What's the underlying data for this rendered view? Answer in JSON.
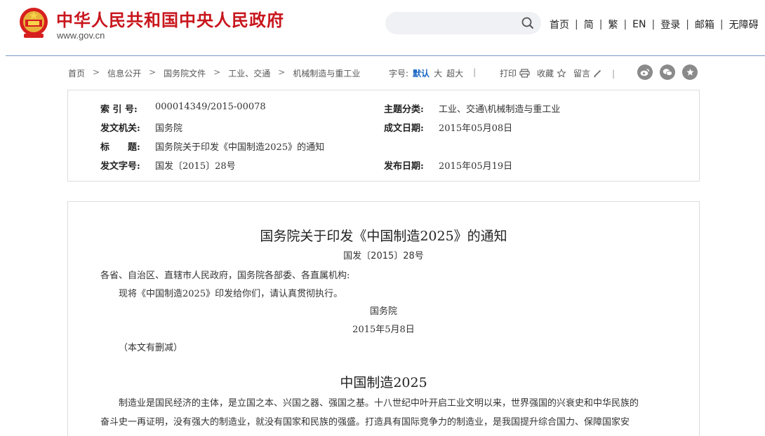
{
  "header": {
    "site_title": "中华人民共和国中央人民政府",
    "site_url": "www.gov.cn",
    "search_placeholder": "",
    "nav": [
      "首页",
      "简",
      "繁",
      "EN",
      "登录",
      "邮箱",
      "无障碍"
    ],
    "brand_color": "#c8161d"
  },
  "toolbar": {
    "breadcrumb": [
      "首页",
      "信息公开",
      "国务院文件",
      "工业、交通",
      "机械制造与重工业"
    ],
    "font_size_label": "字号:",
    "font_sizes": [
      "默认",
      "大",
      "超大"
    ],
    "font_size_selected": "默认",
    "print_label": "打印",
    "favorite_label": "收藏",
    "comment_label": "留言",
    "share_icons": [
      "weibo-icon",
      "wechat-icon",
      "favorite-star-icon"
    ]
  },
  "info": {
    "index_label": "索 引 号:",
    "index_value": "000014349/2015-00078",
    "category_label": "主题分类:",
    "category_value": "工业、交通\\机械制造与重工业",
    "issuer_label": "发文机关:",
    "issuer_value": "国务院",
    "written_date_label": "成文日期:",
    "written_date_value": "2015年05月08日",
    "title_label": "标　　题:",
    "title_value": "国务院关于印发《中国制造2025》的通知",
    "doc_no_label": "发文字号:",
    "doc_no_value": "国发〔2015〕28号",
    "publish_date_label": "发布日期:",
    "publish_date_value": "2015年05月19日"
  },
  "content": {
    "title": "国务院关于印发《中国制造2025》的通知",
    "doc_number": "国发〔2015〕28号",
    "salutation": "各省、自治区、直辖市人民政府，国务院各部委、各直属机构:",
    "body_line": "现将《中国制造2025》印发给你们，请认真贯彻执行。",
    "signature": "国务院",
    "date": "2015年5月8日",
    "note": "（本文有删减）",
    "section_title": "中国制造2025",
    "para1_line1": "制造业是国民经济的主体，是立国之本、兴国之器、强国之基。十八世纪中叶开启工业文明以来，世界强国的兴衰史和中华民族的",
    "para1_line2": "奋斗史一再证明，没有强大的制造业，就没有国家和民族的强盛。打造具有国际竞争力的制造业，是我国提升综合国力、保障国家安"
  }
}
